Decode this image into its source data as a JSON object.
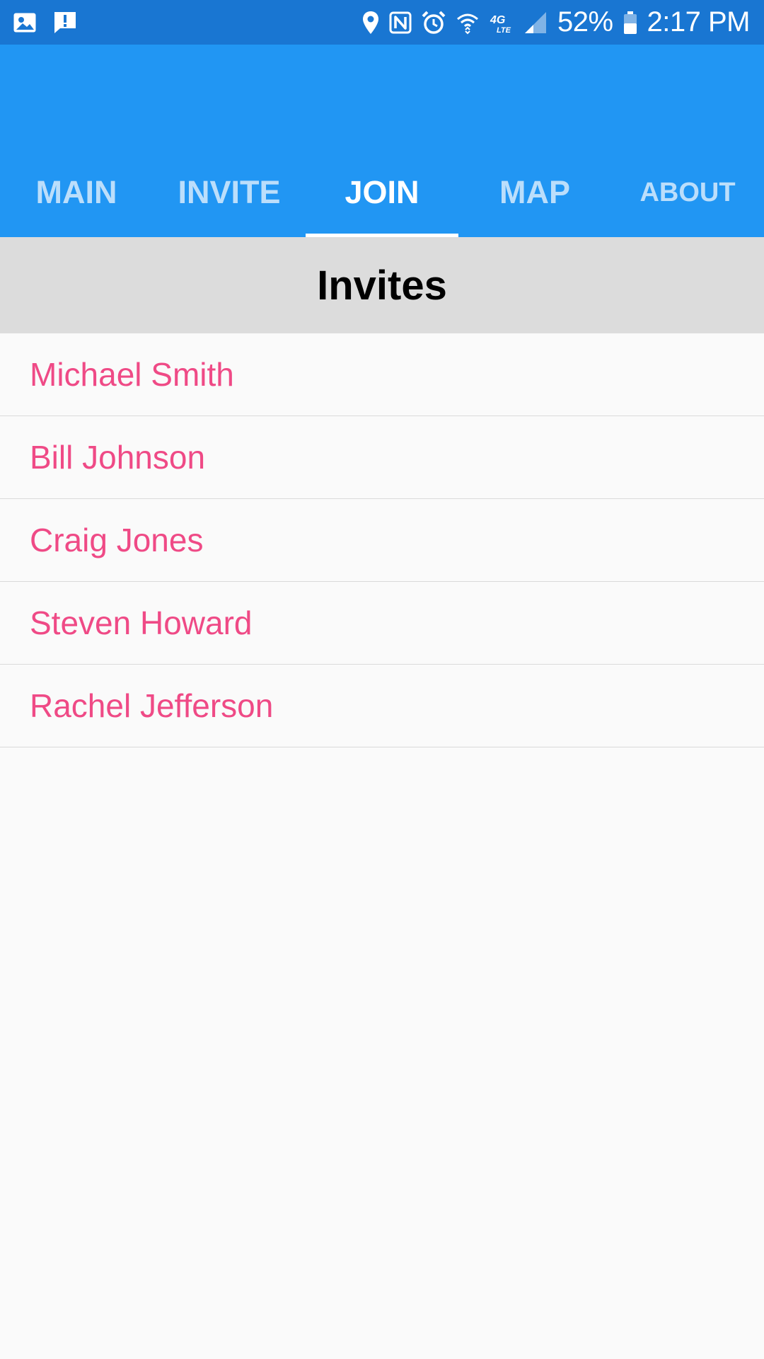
{
  "status_bar": {
    "left_icons": [
      "image-icon",
      "message-alert-icon"
    ],
    "right_icons": [
      "location-icon",
      "nfc-icon",
      "alarm-icon",
      "wifi-icon",
      "lte-icon",
      "signal-icon"
    ],
    "battery": "52%",
    "time": "2:17 PM"
  },
  "colors": {
    "status_bar": "#1976D2",
    "app_bar": "#2196F3",
    "tab_inactive": "#BBDEFB",
    "tab_active": "#FFFFFF",
    "header_bg": "#DCDCDC",
    "list_text": "#EF4A86",
    "background": "#FAFAFA"
  },
  "tabs": [
    {
      "label": "MAIN",
      "active": false
    },
    {
      "label": "INVITE",
      "active": false
    },
    {
      "label": "JOIN",
      "active": true
    },
    {
      "label": "MAP",
      "active": false
    },
    {
      "label": "ABOUT",
      "active": false
    }
  ],
  "header": {
    "title": "Invites"
  },
  "invites": [
    {
      "name": "Michael Smith"
    },
    {
      "name": "Bill Johnson"
    },
    {
      "name": "Craig Jones"
    },
    {
      "name": "Steven Howard"
    },
    {
      "name": "Rachel Jefferson"
    }
  ]
}
